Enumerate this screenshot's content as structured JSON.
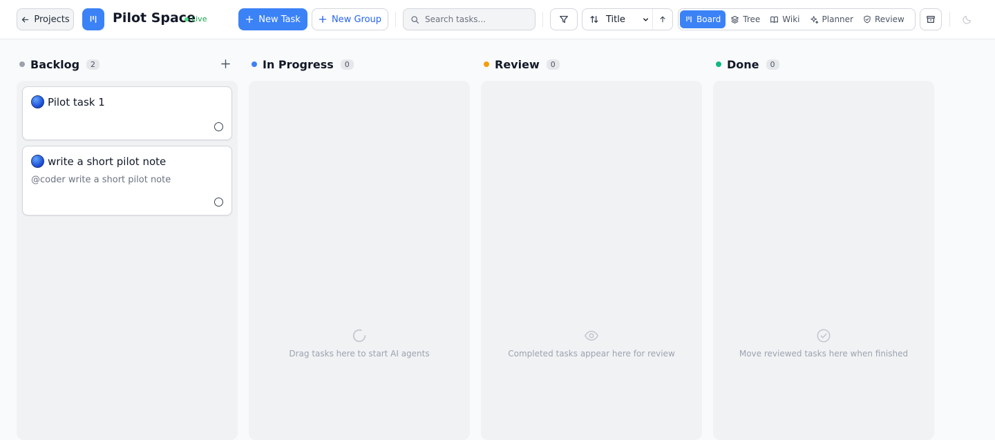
{
  "header": {
    "back_label": "Projects",
    "app_title": "Pilot Space",
    "status": "Live",
    "new_task_label": "New Task",
    "new_group_label": "New Group",
    "search_placeholder": "Search tasks...",
    "sort": {
      "selected": "Title",
      "options": [
        "Title"
      ],
      "direction": "ascending"
    },
    "views": [
      {
        "label": "Board",
        "icon": "board-icon",
        "active": true
      },
      {
        "label": "Tree",
        "icon": "layers-icon",
        "active": false
      },
      {
        "label": "Wiki",
        "icon": "book-icon",
        "active": false
      },
      {
        "label": "Planner",
        "icon": "sparkles-icon",
        "active": false
      },
      {
        "label": "Review",
        "icon": "shield-check-icon",
        "active": false
      }
    ]
  },
  "columns": [
    {
      "title": "Backlog",
      "count": "2",
      "color": "#9ca3af",
      "cards": [
        {
          "title": "Pilot task 1",
          "description": ""
        },
        {
          "title": "write a short pilot note",
          "description": "@coder write a short pilot note"
        }
      ]
    },
    {
      "title": "In Progress",
      "count": "0",
      "color": "#3b82f6",
      "empty_text": "Drag tasks here to start AI agents",
      "empty_icon": "loader-icon"
    },
    {
      "title": "Review",
      "count": "0",
      "color": "#f59e0b",
      "empty_text": "Completed tasks appear here for review",
      "empty_icon": "eye-icon"
    },
    {
      "title": "Done",
      "count": "0",
      "color": "#10b981",
      "empty_text": "Move reviewed tasks here when finished",
      "empty_icon": "check-circle-icon"
    }
  ],
  "colors": {
    "accent": "#3b82f6",
    "live": "#16a34a"
  }
}
